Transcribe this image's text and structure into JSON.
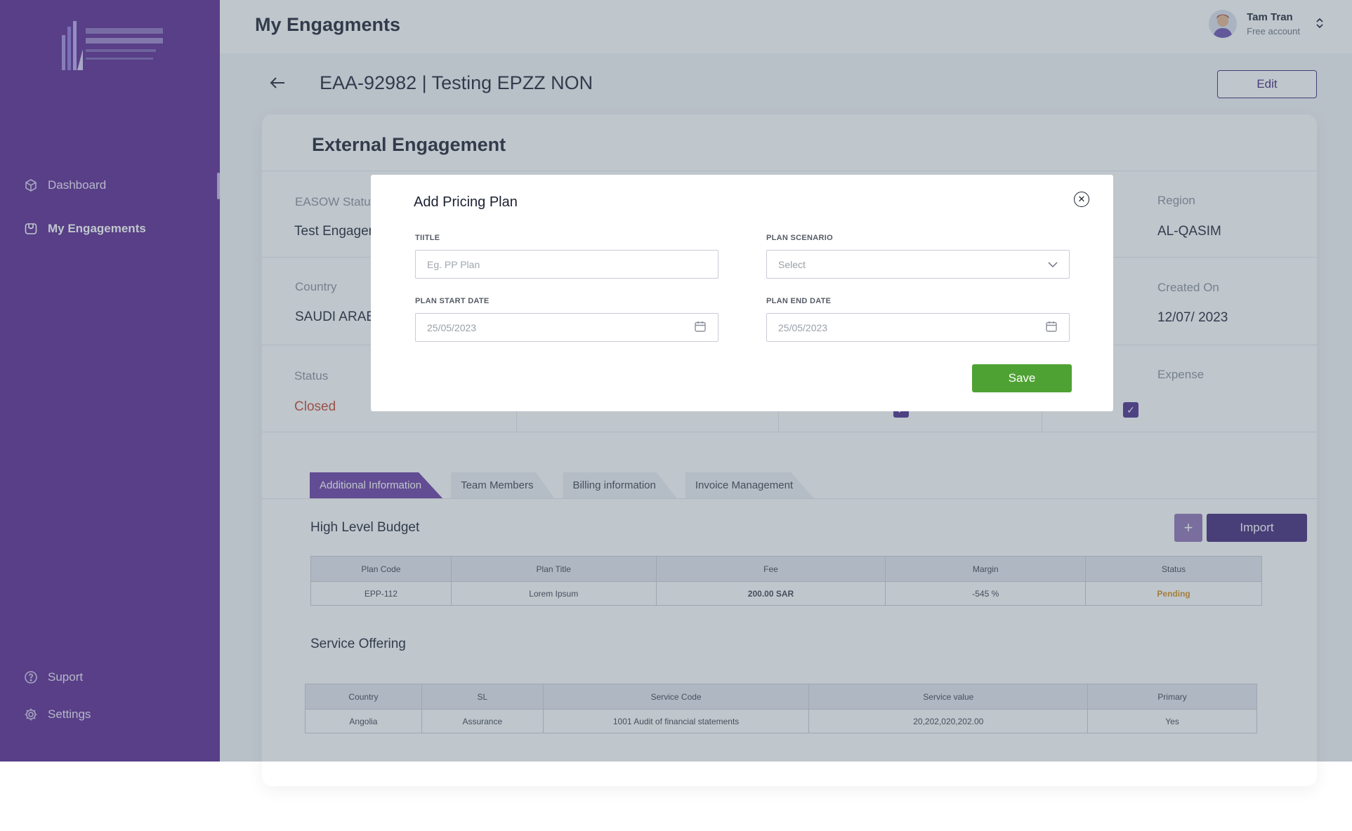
{
  "sidebar": {
    "items": [
      {
        "label": "Dashboard",
        "icon": "cube-icon"
      },
      {
        "label": "My Engagements",
        "icon": "engagements-icon"
      }
    ],
    "bottom": [
      {
        "label": "Suport",
        "icon": "help-circle-icon"
      },
      {
        "label": "Settings",
        "icon": "gear-icon"
      }
    ]
  },
  "header": {
    "title": "My Engagments",
    "user_name": "Tam Tran",
    "user_plan": "Free account"
  },
  "engagement": {
    "title": "EAA-92982 | Testing EPZZ NON",
    "edit_label": "Edit",
    "card_title": "External Engagement",
    "fields": {
      "easow_status_label": "EASOW Status",
      "easow_status_value": "Test Engagement",
      "region_label": "Region",
      "region_value": "AL-QASIM",
      "country_label": "Country",
      "country_value": "SAUDI ARABIA",
      "created_label": "Created On",
      "created_value": "12/07/ 2023",
      "status_label": "Status",
      "status_value": "Closed",
      "expense_label": "Expense"
    }
  },
  "tabs": [
    "Additional Information",
    "Team Members",
    "Billing information",
    "Invoice Management"
  ],
  "budget": {
    "title": "High Level Budget",
    "import_label": "Import",
    "columns": [
      "Plan Code",
      "Plan Title",
      "Fee",
      "Margin",
      "Status"
    ],
    "rows": [
      {
        "code": "EPP-112",
        "title": "Lorem Ipsum",
        "fee": "200.00 SAR",
        "margin": "-545 %",
        "status": "Pending"
      }
    ]
  },
  "service": {
    "title": "Service Offering",
    "columns": [
      "Country",
      "SL",
      "Service Code",
      "Service value",
      "Primary"
    ],
    "rows": [
      {
        "country": "Angolia",
        "sl": "Assurance",
        "code": "1001 Audit of financial statements",
        "value": "20,202,020,202.00",
        "primary": "Yes"
      }
    ]
  },
  "modal": {
    "title": "Add Pricing Plan",
    "title_label": "TIITLE",
    "title_placeholder": "Eg. PP Plan",
    "scenario_label": "PLAN SCENARIO",
    "scenario_value": "Select",
    "start_label": "PLAN START DATE",
    "start_value": "25/05/2023",
    "end_label": "PLAN END DATE",
    "end_value": "25/05/2023",
    "save_label": "Save"
  },
  "colors": {
    "sidebar": "#5a2690",
    "primary": "#3f2478",
    "save": "#4ea233",
    "pending": "#d08c1b",
    "closed": "#c6452f"
  }
}
